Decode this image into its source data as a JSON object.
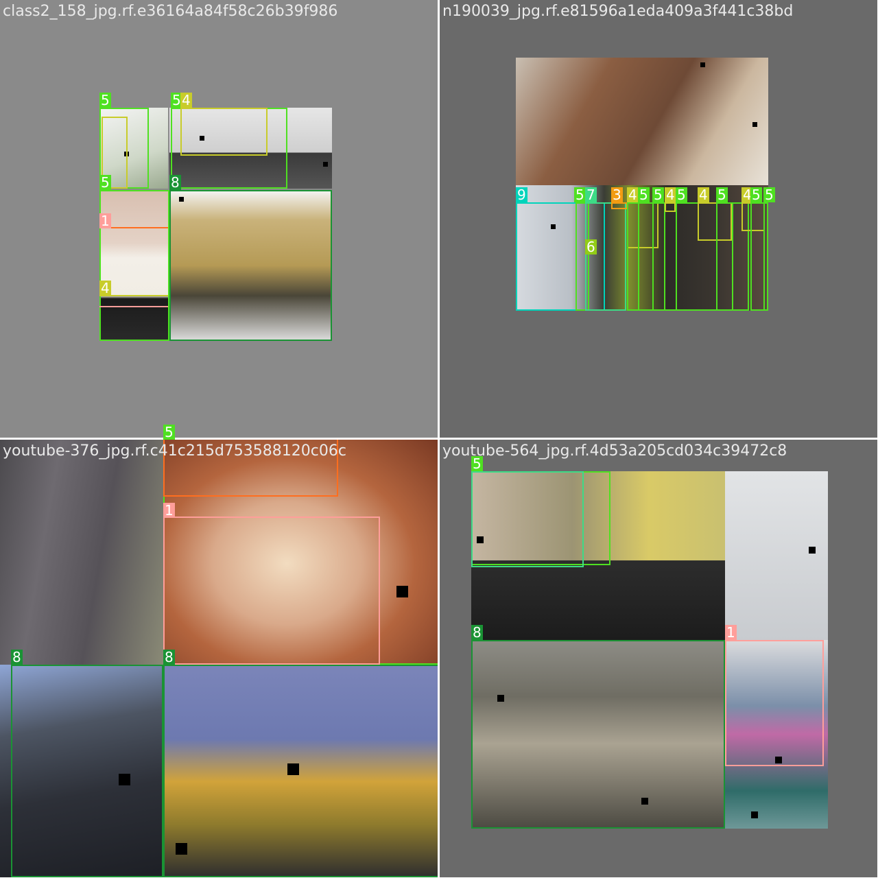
{
  "tiles": [
    {
      "title": "class2_158_jpg.rf.e36164a84f58c26b39f986"
    },
    {
      "title": "n190039_jpg.rf.e81596a1eda409a3f441c38bd"
    },
    {
      "title": "youtube-376_jpg.rf.c41c215d753588120c06c"
    },
    {
      "title": "youtube-564_jpg.rf.4d53a205cd034c39472c8"
    }
  ],
  "colors": {
    "class_1": "#ff9e9a",
    "class_3": "#f39c12",
    "class_4": "#c8cc2a",
    "class_5": "#4fe021",
    "class_6": "#92cc17",
    "class_7": "#3ddb86",
    "class_8": "#1a9334",
    "class_9": "#00d4bb",
    "orange": "#ff6e1f",
    "divider": "#ffffff",
    "bg_gray": "#888888",
    "bg_dark": "#6a6a6a"
  },
  "labels": {
    "c1": "1",
    "c3": "3",
    "c4": "4",
    "c5": "5",
    "c6": "6",
    "c7": "7",
    "c8": "8",
    "c9": "9"
  }
}
